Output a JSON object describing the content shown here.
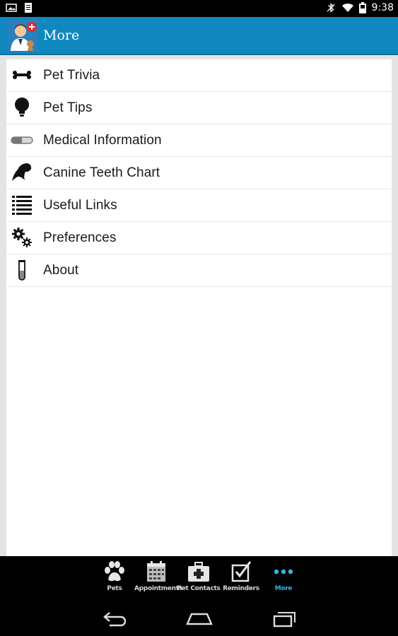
{
  "status_bar": {
    "time": "9:38",
    "icons": [
      "notification-image-icon",
      "notification-doc-icon",
      "bluetooth-icon",
      "wifi-icon",
      "battery-icon"
    ]
  },
  "action_bar": {
    "title": "More",
    "accent": "#1087bf"
  },
  "menu": {
    "items": [
      {
        "label": "Pet Trivia",
        "icon": "bone-icon"
      },
      {
        "label": "Pet Tips",
        "icon": "lightbulb-icon"
      },
      {
        "label": "Medical Information",
        "icon": "capsule-icon"
      },
      {
        "label": "Canine Teeth Chart",
        "icon": "tooth-icon"
      },
      {
        "label": "Useful Links",
        "icon": "list-icon"
      },
      {
        "label": "Preferences",
        "icon": "gears-icon"
      },
      {
        "label": "About",
        "icon": "test-tube-icon"
      }
    ]
  },
  "tabs": [
    {
      "label": "Pets",
      "icon": "paw-icon"
    },
    {
      "label": "Appointments",
      "icon": "calendar-icon"
    },
    {
      "label": "Pet Contacts",
      "icon": "medkit-icon"
    },
    {
      "label": "Reminders",
      "icon": "checkbox-icon"
    },
    {
      "label": "More",
      "icon": "more-dots-icon",
      "active": true
    }
  ],
  "active_tab_color": "#33b5e5"
}
